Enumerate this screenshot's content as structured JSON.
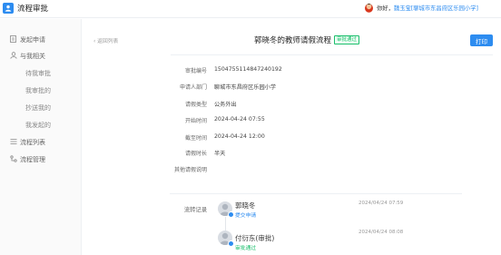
{
  "app": {
    "title": "流程审批",
    "greeting_prefix": "你好，",
    "user_name": "魏玉宝",
    "user_org": "[聊城市东昌府区乐园小学]"
  },
  "sidebar": {
    "items": [
      {
        "label": "发起申请",
        "icon": "edit-icon"
      },
      {
        "label": "与我相关",
        "icon": "user-icon"
      },
      {
        "label": "待我审批",
        "sub": true
      },
      {
        "label": "我审批的",
        "sub": true
      },
      {
        "label": "抄送我的",
        "sub": true
      },
      {
        "label": "我发起的",
        "sub": true
      },
      {
        "label": "流程列表",
        "icon": "list-icon"
      },
      {
        "label": "流程管理",
        "icon": "branch-icon"
      }
    ]
  },
  "detail": {
    "back_label": "‹ 返回列表",
    "title": "郭晓冬的教师请假流程",
    "status": "审批通过",
    "print_label": "打印",
    "fields": [
      {
        "label": "审批编号",
        "value": "1504755114847240192"
      },
      {
        "label": "申请人部门",
        "value": "聊城市东昌府区乐园小学"
      },
      {
        "label": "请假类型",
        "value": "公务外出"
      },
      {
        "label": "开始时间",
        "value": "2024-04-24 07:55"
      },
      {
        "label": "截至时间",
        "value": "2024-04-24 12:00"
      },
      {
        "label": "请假时长",
        "value": "半天"
      },
      {
        "label": "其他请假说明",
        "value": ""
      }
    ],
    "log_label": "流转记录",
    "log": [
      {
        "name": "郭晓冬",
        "action": "提交申请",
        "time": "2024/04/24 07:59",
        "action_color": "#2d8cf0"
      },
      {
        "name": "付衍东(审批)",
        "action": "审批通过",
        "time": "2024/04/24 08:08",
        "action_color": "#19be6b"
      }
    ]
  },
  "colors": {
    "accent": "#2d8cf0",
    "success": "#19be6b"
  }
}
